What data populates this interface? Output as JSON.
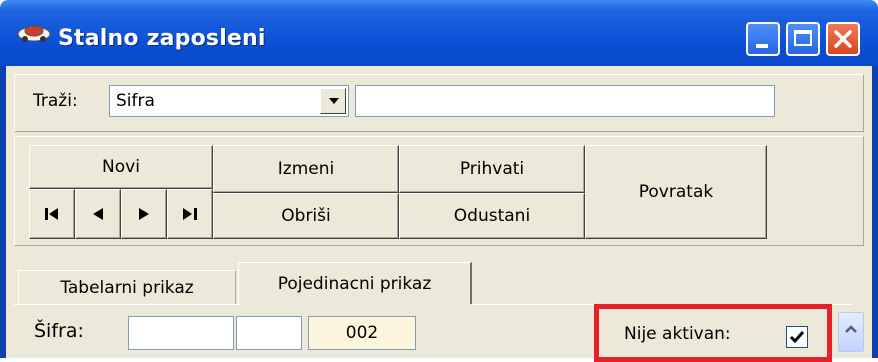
{
  "window": {
    "title": "Stalno zaposleni",
    "app_icon": "car-icon",
    "controls": [
      "minimize-icon",
      "maximize-icon",
      "close-icon"
    ]
  },
  "search": {
    "label": "Traži:",
    "field_value": "Sifra",
    "query_value": ""
  },
  "toolbar": {
    "novi": "Novi",
    "izmeni": "Izmeni",
    "prihvati": "Prihvati",
    "povratak": "Povratak",
    "obrisi": "Obriši",
    "odustani": "Odustani",
    "nav_icons": [
      "first-record-icon",
      "previous-record-icon",
      "next-record-icon",
      "last-record-icon"
    ]
  },
  "tabs": [
    {
      "label": "Tabelarni prikaz",
      "active": false
    },
    {
      "label": "Pojedinacni prikaz",
      "active": true
    }
  ],
  "form": {
    "sifra_label": "Šifra:",
    "sifra_part1": "",
    "sifra_part2": "",
    "sifra_code": "002",
    "nije_aktivan_label": "Nije aktivan:",
    "nije_aktivan_checked": true
  },
  "colors": {
    "titlebar": "#0a47c8",
    "highlight": "#e8202a",
    "face": "#ece9d8"
  }
}
